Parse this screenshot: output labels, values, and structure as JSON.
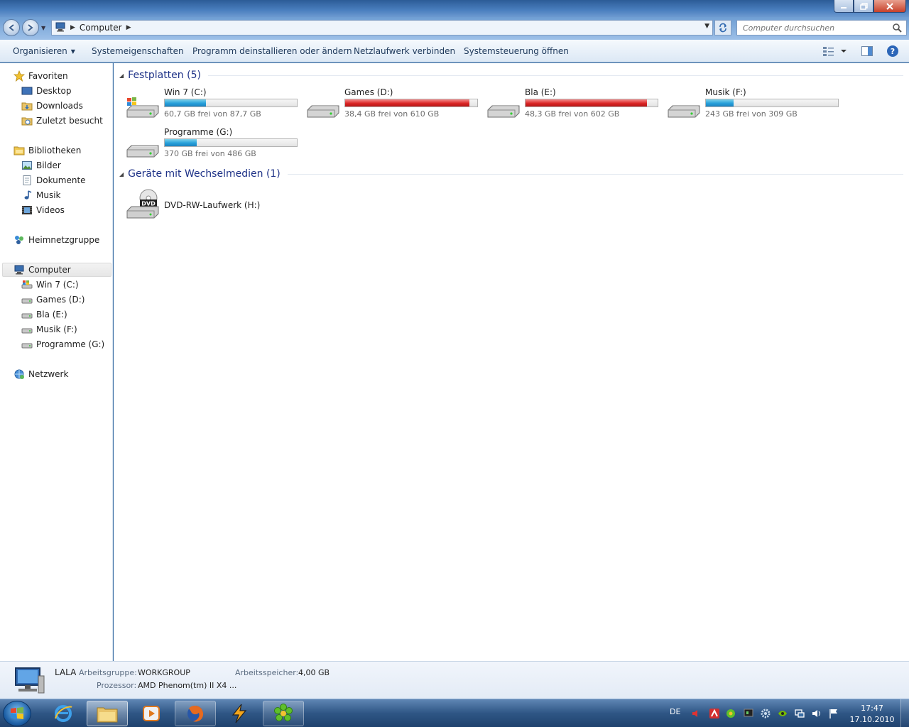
{
  "window": {
    "controls": {
      "minimize": "minimize-icon",
      "maximize": "restore-icon",
      "close": "close-icon"
    }
  },
  "address_bar": {
    "crumb": "Computer",
    "search_placeholder": "Computer durchsuchen"
  },
  "command_bar": {
    "organize": "Organisieren",
    "system_properties": "Systemeigenschaften",
    "uninstall": "Programm deinstallieren oder ändern",
    "map_drive": "Netzlaufwerk verbinden",
    "control_panel": "Systemsteuerung öffnen"
  },
  "nav": {
    "favorites": {
      "label": "Favoriten",
      "items": [
        "Desktop",
        "Downloads",
        "Zuletzt besucht"
      ]
    },
    "libraries": {
      "label": "Bibliotheken",
      "items": [
        "Bilder",
        "Dokumente",
        "Musik",
        "Videos"
      ]
    },
    "homegroup": "Heimnetzgruppe",
    "computer": {
      "label": "Computer",
      "items": [
        "Win 7 (C:)",
        "Games (D:)",
        "Bla (E:)",
        "Musik (F:)",
        "Programme (G:)"
      ]
    },
    "network": "Netzwerk"
  },
  "groups": {
    "hard_disks": {
      "title": "Festplatten (5)",
      "drives": [
        {
          "name": "Win 7 (C:)",
          "free_text": "60,7 GB frei von 87,7 GB",
          "used_fraction": 0.31,
          "status": "blue"
        },
        {
          "name": "Games (D:)",
          "free_text": "38,4 GB frei von 610 GB",
          "used_fraction": 0.94,
          "status": "red"
        },
        {
          "name": "Bla (E:)",
          "free_text": "48,3 GB frei von 602 GB",
          "used_fraction": 0.92,
          "status": "red"
        },
        {
          "name": "Musik (F:)",
          "free_text": "243 GB frei von 309 GB",
          "used_fraction": 0.21,
          "status": "blue"
        },
        {
          "name": "Programme (G:)",
          "free_text": "370 GB frei von 486 GB",
          "used_fraction": 0.24,
          "status": "blue"
        }
      ]
    },
    "removable": {
      "title": "Geräte mit Wechselmedien (1)",
      "drives": [
        {
          "name": "DVD-RW-Laufwerk (H:)",
          "icon_label": "DVD"
        }
      ]
    }
  },
  "details": {
    "pc_name": "LALA",
    "workgroup_label": "Arbeitsgruppe:",
    "workgroup_value": "WORKGROUP",
    "memory_label": "Arbeitsspeicher:",
    "memory_value": "4,00 GB",
    "cpu_label": "Prozessor:",
    "cpu_value": "AMD Phenom(tm) II X4 ..."
  },
  "taskbar": {
    "language": "DE",
    "time": "17:47",
    "date": "17.10.2010"
  },
  "colors": {
    "bar_blue": "#26a0da",
    "bar_red": "#da2626",
    "group_title": "#1e3287"
  }
}
